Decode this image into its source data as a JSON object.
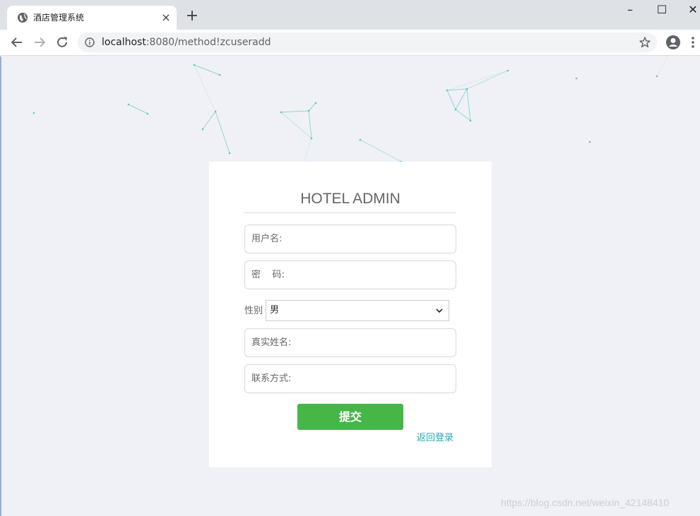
{
  "browser": {
    "tab_title": "酒店管理系统",
    "tab_close": "×",
    "new_tab": "+",
    "url_host": "localhost",
    "url_rest": ":8080/method!zcuseradd",
    "window_minimize": "–",
    "window_maximize": "☐",
    "window_close": "✕"
  },
  "form": {
    "title": "HOTEL ADMIN",
    "username_placeholder": "用户名:",
    "password_placeholder": "密    码:",
    "gender_label": "性别",
    "gender_value": "男",
    "realname_placeholder": "真实姓名:",
    "contact_placeholder": "联系方式:",
    "submit_label": "提交",
    "back_link": "返回登录"
  },
  "watermark": "https://blog.csdn.net/weixin_42148410",
  "colors": {
    "submit_bg": "#46b649",
    "link": "#23a8b4",
    "page_bg": "#eff1f6",
    "particle": "#5ec4bd"
  }
}
